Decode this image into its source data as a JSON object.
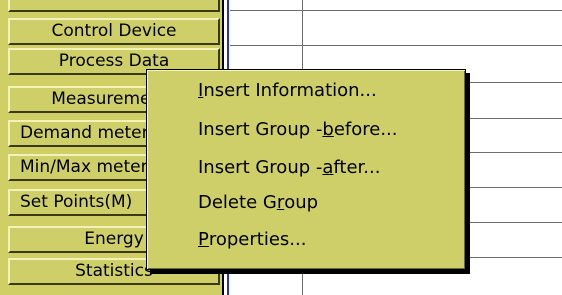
{
  "sidebar": {
    "items": [
      {
        "label": "Control Device"
      },
      {
        "label": "Process Data"
      },
      {
        "label": "Measurements"
      },
      {
        "label": "Demand meter"
      },
      {
        "label": "Min/Max meter"
      },
      {
        "label": "Set Points(M)"
      },
      {
        "label": "Energy"
      },
      {
        "label": "Statistics"
      }
    ]
  },
  "context_menu": {
    "items": [
      {
        "pre": "",
        "mnemonic": "I",
        "post": "nsert Information..."
      },
      {
        "pre": "Insert Group - ",
        "mnemonic": "b",
        "post": "efore..."
      },
      {
        "pre": "Insert Group - ",
        "mnemonic": "a",
        "post": "fter..."
      },
      {
        "pre": "Delete G",
        "mnemonic": "r",
        "post": "oup"
      },
      {
        "pre": "",
        "mnemonic": "P",
        "post": "roperties..."
      }
    ]
  },
  "colors": {
    "sidebar_bg": "#cfcf6a",
    "menu_bg": "#cfcf6a",
    "divider_blue": "#1f2fe0",
    "grid_line": "#6d6d6d"
  }
}
